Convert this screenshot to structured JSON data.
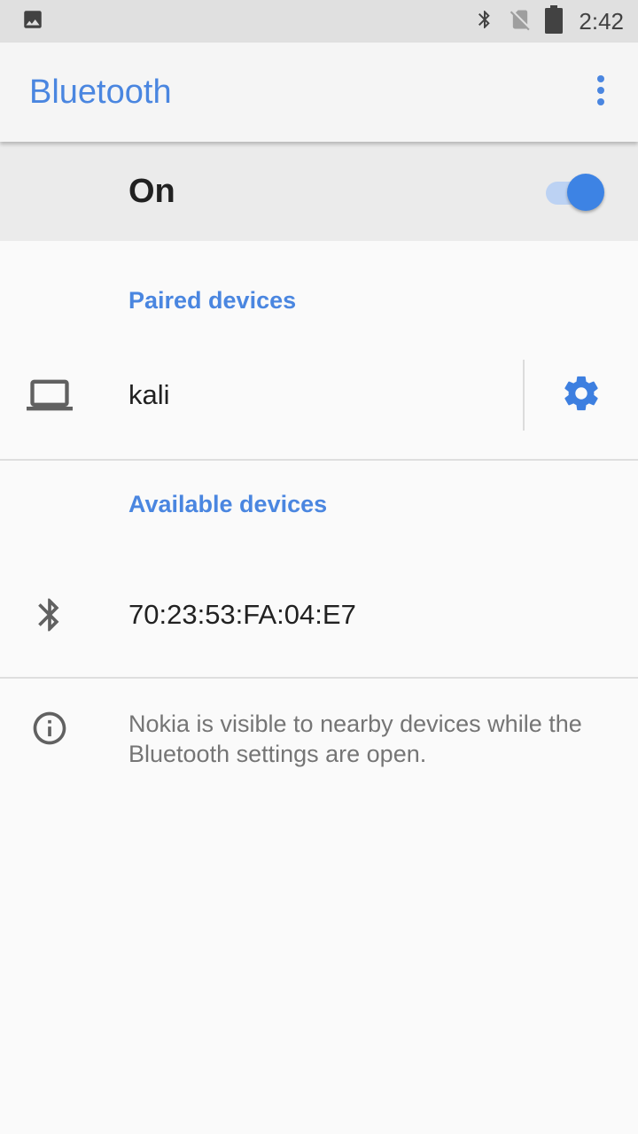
{
  "status_bar": {
    "time": "2:42",
    "icons": [
      "image-icon",
      "bluetooth-icon",
      "no-sim-icon",
      "battery-icon"
    ]
  },
  "app_bar": {
    "title": "Bluetooth",
    "overflow_icon": "more-vert-icon"
  },
  "master_switch": {
    "label": "On",
    "checked": true
  },
  "paired": {
    "header": "Paired devices",
    "devices": [
      {
        "name": "kali",
        "icon": "laptop-icon",
        "settings_icon": "gear-icon"
      }
    ]
  },
  "available": {
    "header": "Available devices",
    "devices": [
      {
        "name": "70:23:53:FA:04:E7",
        "icon": "bluetooth-icon"
      }
    ]
  },
  "footer": {
    "icon": "info-icon",
    "text": "Nokia is visible to nearby devices while the Bluetooth settings are open."
  },
  "colors": {
    "accent": "#4a86e0",
    "switch_thumb": "#3d83e4",
    "switch_track": "#bcd2f3",
    "status_bar": "#e0e0e0",
    "icon_gray": "#616161"
  }
}
